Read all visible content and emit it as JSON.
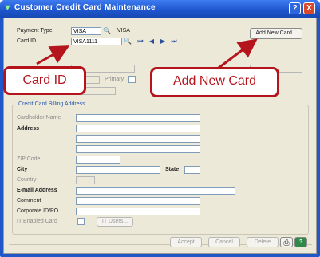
{
  "window": {
    "title": "Customer Credit Card Maintenance",
    "help_button": "?",
    "close_button": "X"
  },
  "header": {
    "payment_type_label": "Payment Type",
    "payment_type_value": "VISA",
    "payment_type_description": "VISA",
    "card_id_label": "Card ID",
    "card_id_value": "VISA1111",
    "add_new_card_button": "Add New Card...",
    "primary_label": "Primary"
  },
  "billing": {
    "group_title": "Credit Card Billing Address",
    "cardholder_name_label": "Cardholder Name",
    "address_label": "Address",
    "zip_code_label": "ZIP Code",
    "city_label": "City",
    "state_label": "State",
    "country_label": "Country",
    "email_label": "E-mail Address",
    "comment_label": "Comment",
    "corporate_id_label": "Corporate ID/PO",
    "it_enabled_label": "IT Enabled Card",
    "it_users_button": "IT Users..."
  },
  "footer": {
    "accept_button": "Accept",
    "cancel_button": "Cancel",
    "delete_button": "Delete"
  },
  "callouts": {
    "card_id": "Card ID",
    "add_new_card": "Add New Card"
  },
  "colors": {
    "titlebar": "#1d55cc",
    "dialog_background": "#ece9d8",
    "callout_red": "#b5141c"
  }
}
